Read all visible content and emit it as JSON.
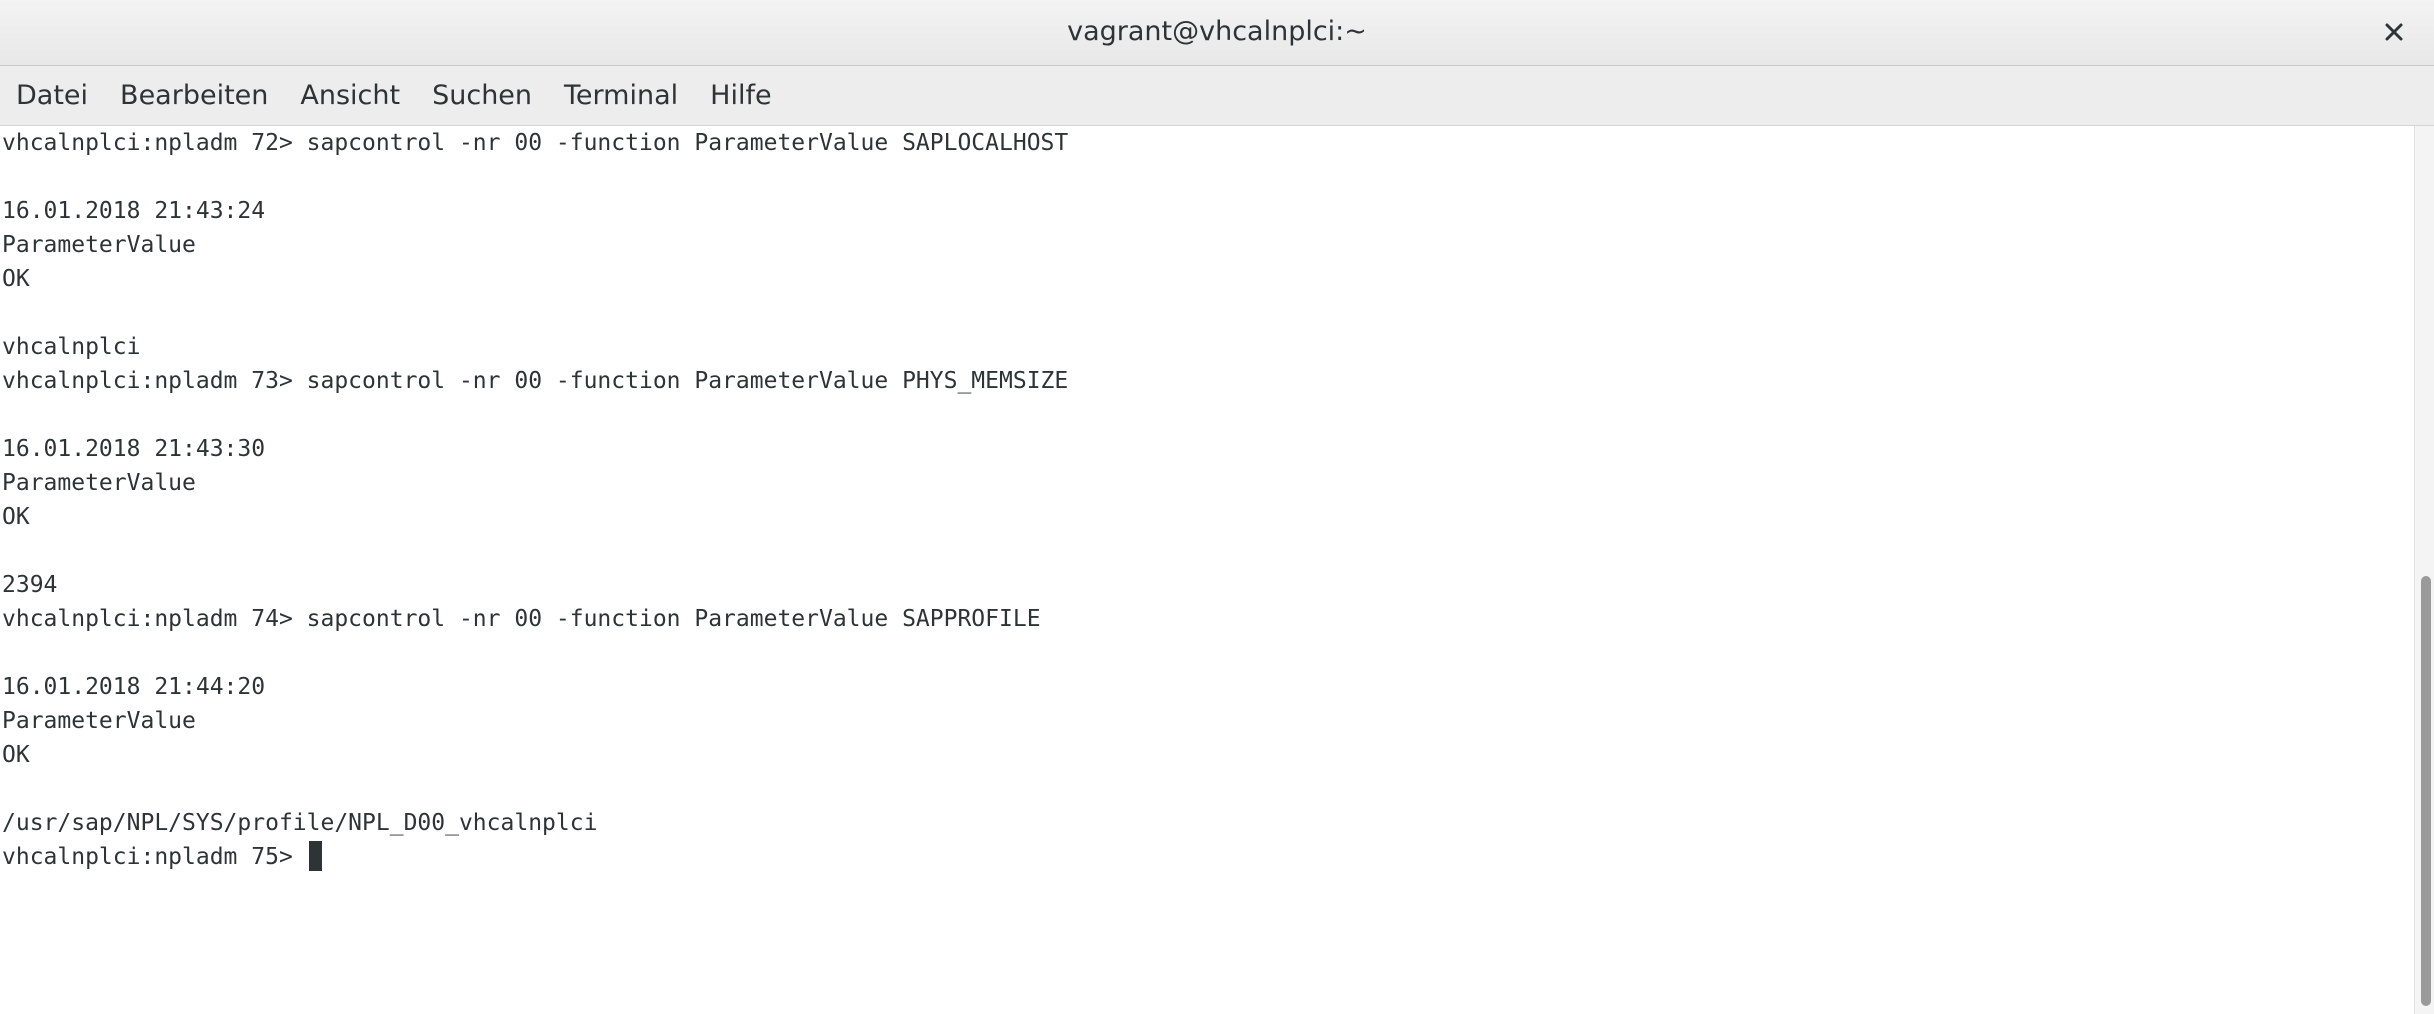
{
  "window": {
    "title": "vagrant@vhcalnplci:~"
  },
  "menu": {
    "items": [
      "Datei",
      "Bearbeiten",
      "Ansicht",
      "Suchen",
      "Terminal",
      "Hilfe"
    ]
  },
  "terminal": {
    "lines": [
      "vhcalnplci:npladm 72> sapcontrol -nr 00 -function ParameterValue SAPLOCALHOST",
      "",
      "16.01.2018 21:43:24",
      "ParameterValue",
      "OK",
      "",
      "vhcalnplci",
      "vhcalnplci:npladm 73> sapcontrol -nr 00 -function ParameterValue PHYS_MEMSIZE",
      "",
      "16.01.2018 21:43:30",
      "ParameterValue",
      "OK",
      "",
      "2394",
      "vhcalnplci:npladm 74> sapcontrol -nr 00 -function ParameterValue SAPPROFILE",
      "",
      "16.01.2018 21:44:20",
      "ParameterValue",
      "OK",
      "",
      "/usr/sap/NPL/SYS/profile/NPL_D00_vhcalnplci"
    ],
    "prompt": "vhcalnplci:npladm 75> "
  }
}
